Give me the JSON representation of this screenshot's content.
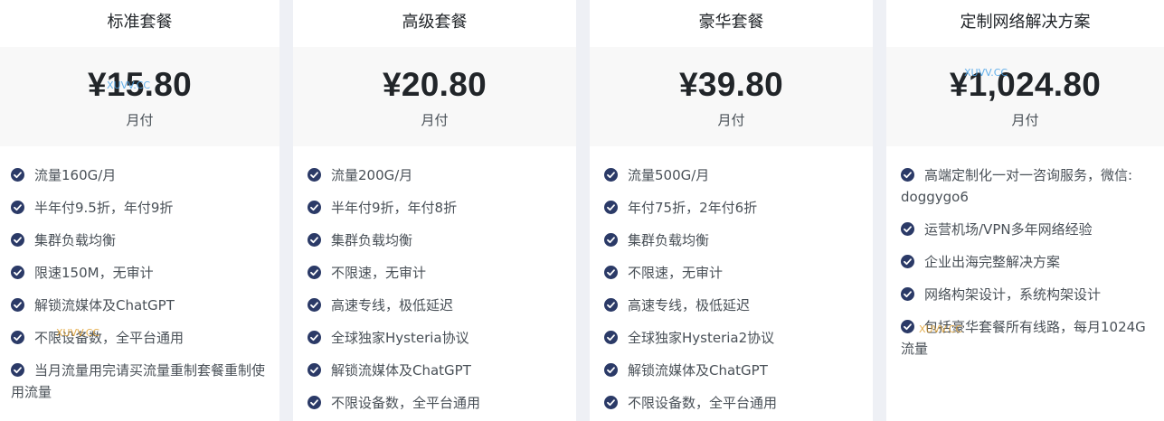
{
  "plans": [
    {
      "name": "标准套餐",
      "price": "¥15.80",
      "period": "月付",
      "features": [
        "流量160G/月",
        "半年付9.5折，年付9折",
        "集群负载均衡",
        "限速150M，无审计",
        "解锁流媒体及ChatGPT",
        "不限设备数，全平台通用",
        "当月流量用完请买流量重制套餐重制使用流量"
      ]
    },
    {
      "name": "高级套餐",
      "price": "¥20.80",
      "period": "月付",
      "features": [
        "流量200G/月",
        "半年付9折，年付8折",
        "集群负载均衡",
        "不限速，无审计",
        "高速专线，极低延迟",
        "全球独家Hysteria协议",
        "解锁流媒体及ChatGPT",
        "不限设备数，全平台通用"
      ]
    },
    {
      "name": "豪华套餐",
      "price": "¥39.80",
      "period": "月付",
      "features": [
        "流量500G/月",
        "年付75折，2年付6折",
        "集群负载均衡",
        "不限速，无审计",
        "高速专线，极低延迟",
        "全球独家Hysteria2协议",
        "解锁流媒体及ChatGPT",
        "不限设备数，全平台通用"
      ]
    },
    {
      "name": "定制网络解决方案",
      "price": "¥1,024.80",
      "period": "月付",
      "features": [
        "高端定制化一对一咨询服务，微信: doggygo6",
        "运营机场/VPN多年网络经验",
        "企业出海完整解决方案",
        "网络构架设计，系统构架设计",
        "包括豪华套餐所有线路，每月1024G流量"
      ]
    }
  ],
  "watermark": "XUVV.CC",
  "colors": {
    "check": "#2b3a67",
    "price_bg": "#f8f8f8",
    "page_bg": "#eef0f5",
    "watermark_blue": "#4aa3e8",
    "watermark_gold": "#e0a030"
  }
}
